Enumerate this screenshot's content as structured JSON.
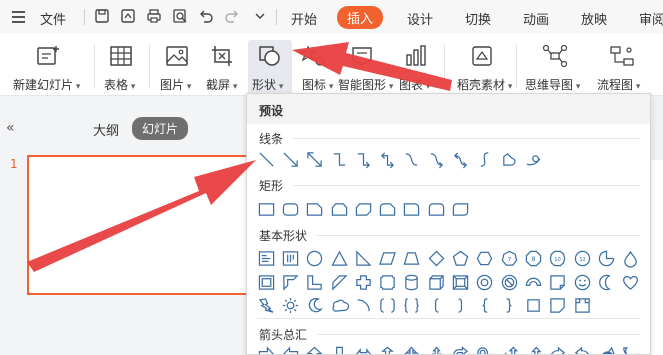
{
  "menubar": {
    "file": "文件",
    "tabs": [
      {
        "label": "开始",
        "active": false
      },
      {
        "label": "插入",
        "active": true
      },
      {
        "label": "设计",
        "active": false
      },
      {
        "label": "切换",
        "active": false
      },
      {
        "label": "动画",
        "active": false
      },
      {
        "label": "放映",
        "active": false
      },
      {
        "label": "审阅",
        "active": false
      }
    ]
  },
  "ribbon": {
    "new_slide": "新建幻灯片",
    "table": "表格",
    "picture": "图片",
    "screenshot": "截屏",
    "shape": "形状",
    "icon": "图标",
    "smart_graphic": "智能图形",
    "chart": "图表",
    "template_material": "稻壳素材",
    "mind_map": "思维导图",
    "flowchart": "流程图"
  },
  "left_pane": {
    "outline": "大纲",
    "slides": "幻灯片",
    "slide_number": "1"
  },
  "shapes_dropdown": {
    "header": "预设",
    "sections": {
      "lines": "线条",
      "rectangles": "矩形",
      "basic_shapes": "基本形状",
      "block_arrows": "箭头总汇"
    }
  },
  "colors": {
    "accent": "#f2622e",
    "shape_stroke": "#3a6ea5",
    "annotation_arrow": "#e8403f"
  }
}
